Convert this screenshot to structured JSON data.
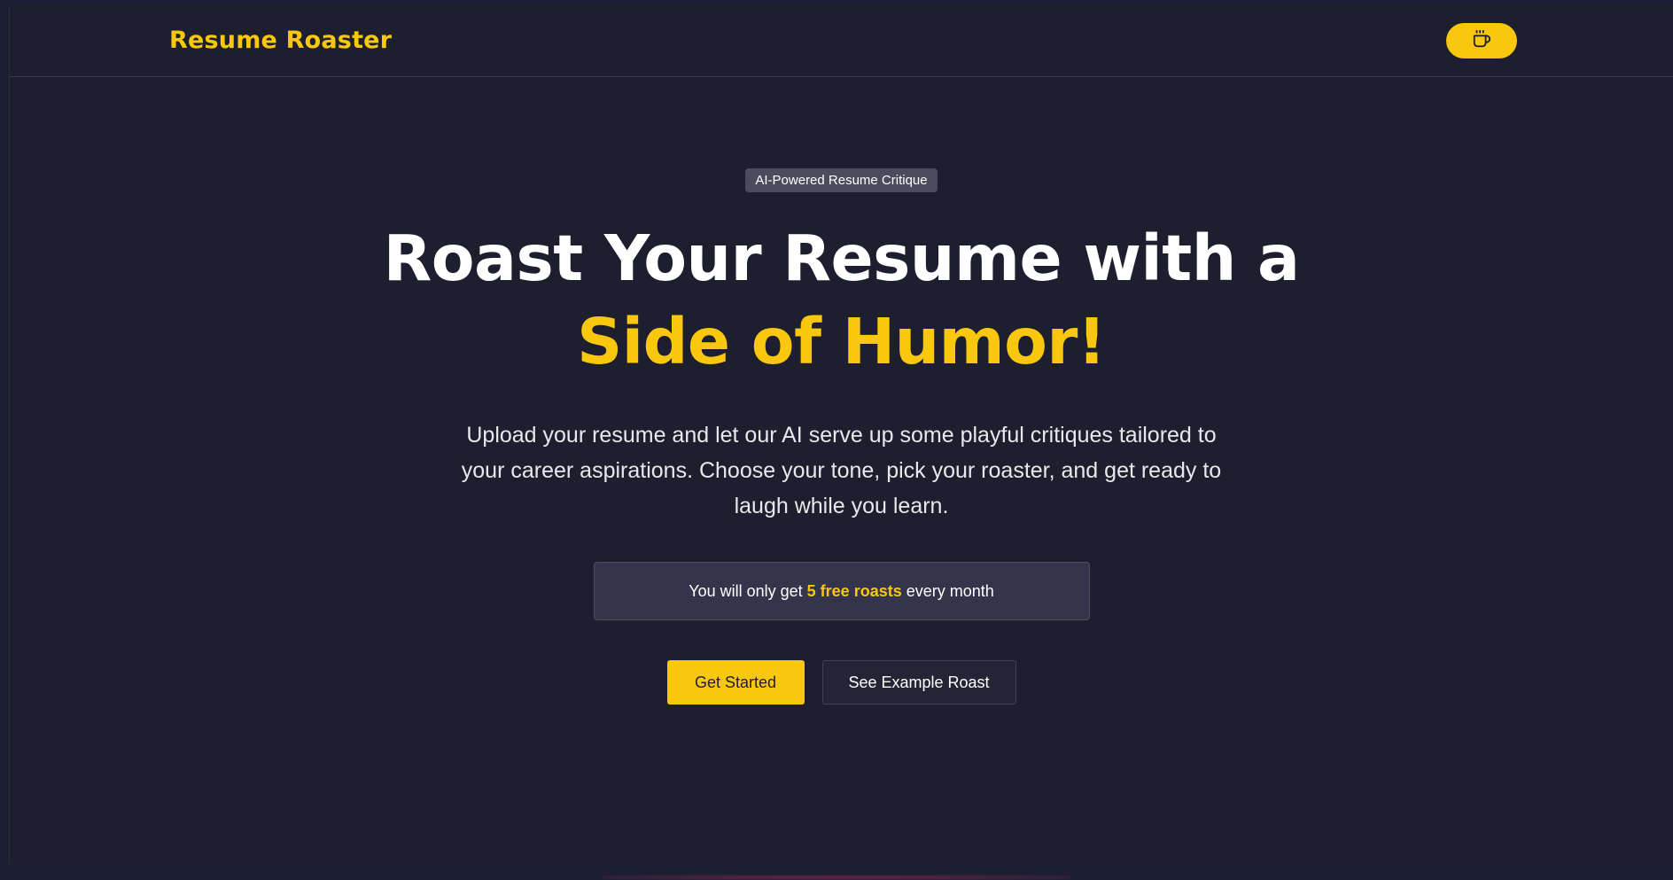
{
  "header": {
    "brand": "Resume Roaster",
    "coffee_icon": "coffee-cup-icon"
  },
  "hero": {
    "badge": "AI-Powered Resume Critique",
    "headline_line1": "Roast Your Resume with a",
    "headline_line2": "Side of Humor!",
    "subtitle": "Upload your resume and let our AI serve up some playful critiques tailored to your career aspirations. Choose your tone, pick your roaster, and get ready to laugh while you learn.",
    "notice_prefix": "You will only get ",
    "notice_highlight": "5 free roasts",
    "notice_suffix": " every month",
    "primary_button": "Get Started",
    "secondary_button": "See Example Roast"
  },
  "colors": {
    "accent": "#f9c80e",
    "background": "#1e1f2e",
    "text": "#ffffff"
  }
}
